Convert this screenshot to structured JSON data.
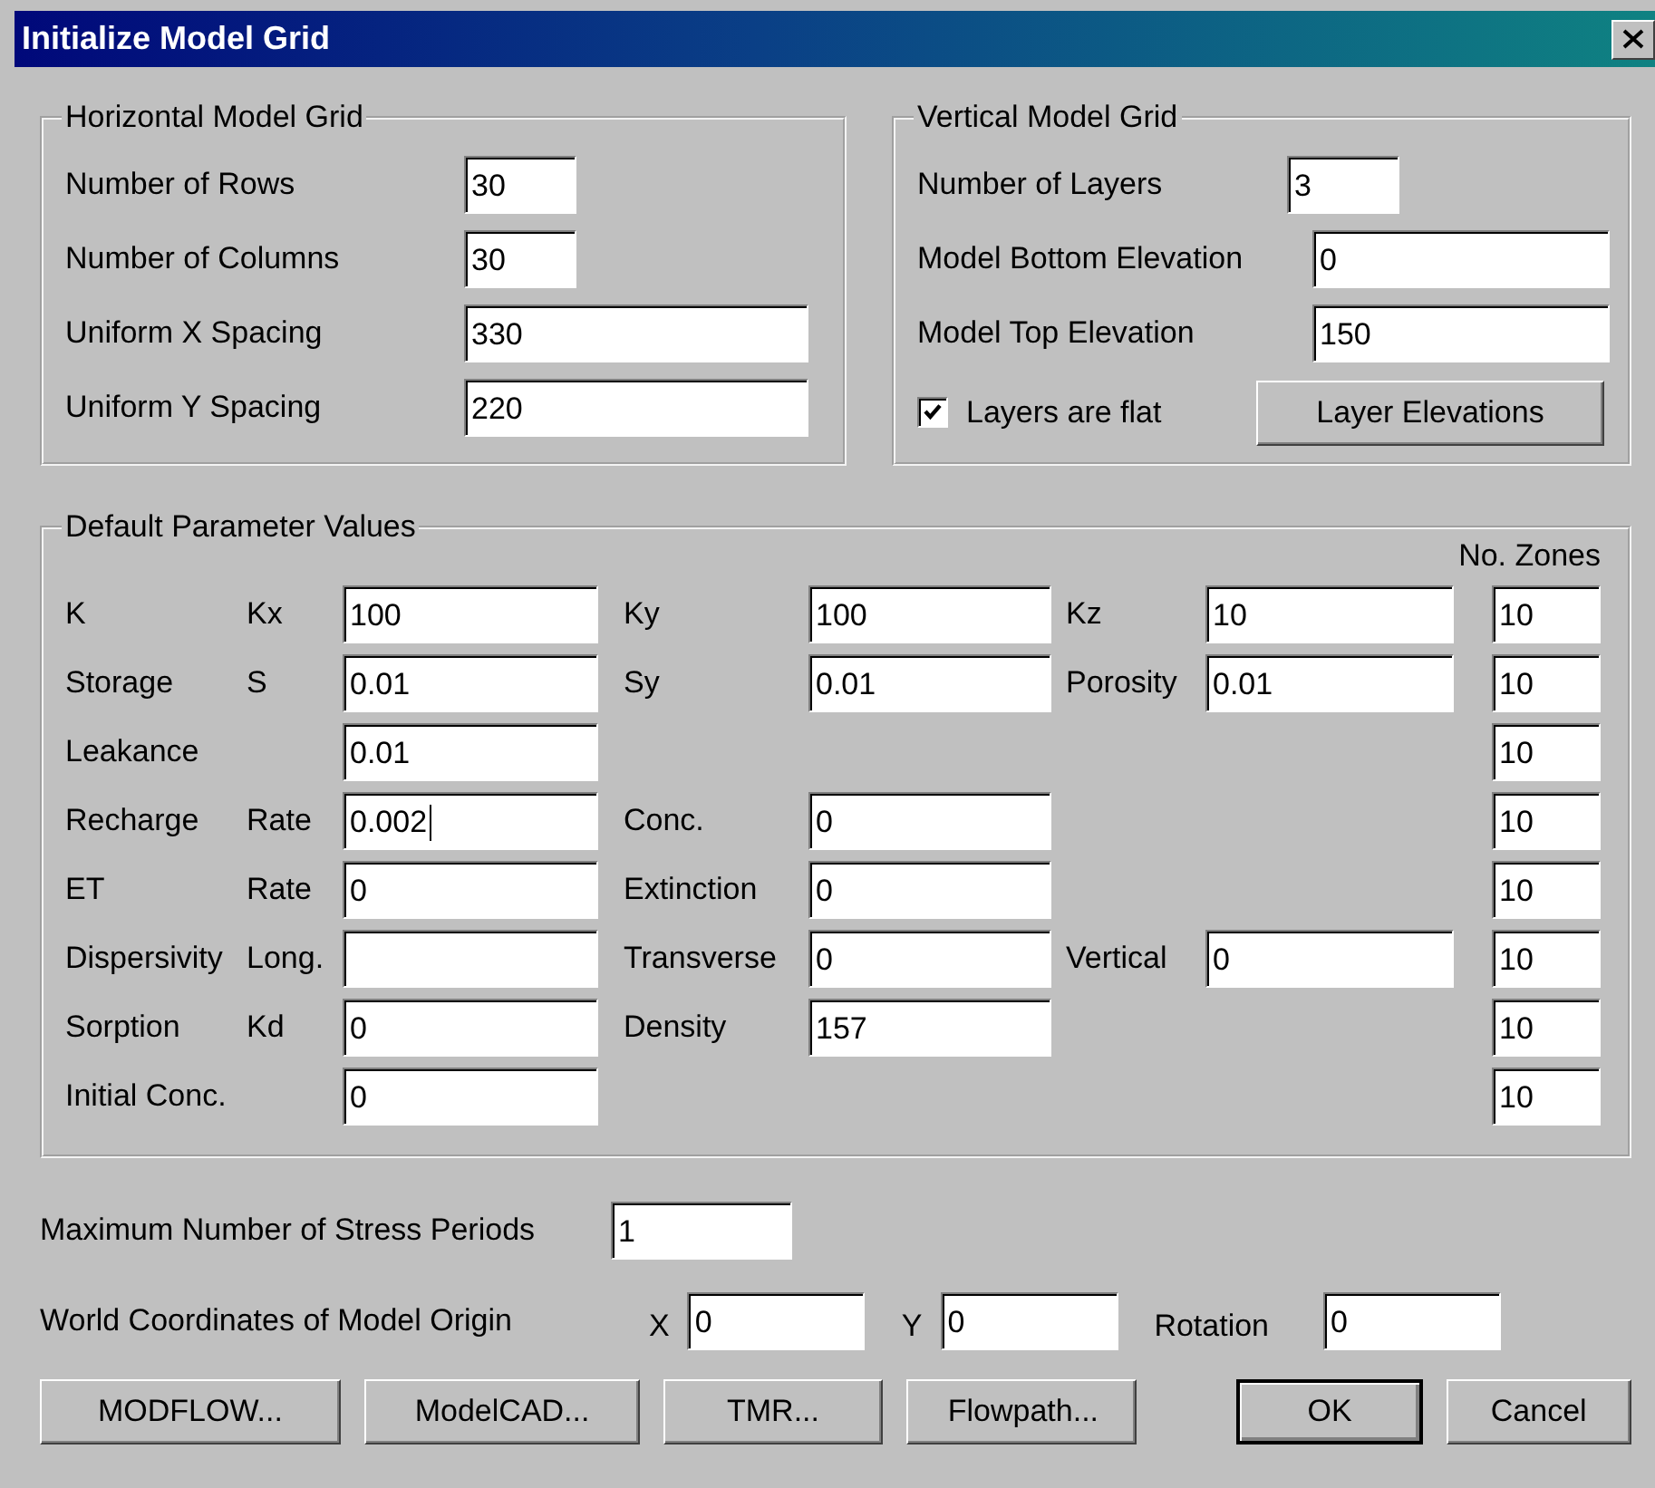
{
  "window": {
    "title": "Initialize Model Grid"
  },
  "horizontal_grid": {
    "title": "Horizontal Model Grid",
    "fields": [
      {
        "label": "Number of Rows",
        "value": "30",
        "kind": "short"
      },
      {
        "label": "Number of Columns",
        "value": "30",
        "kind": "short"
      },
      {
        "label": "Uniform X Spacing",
        "value": "330",
        "kind": "long"
      },
      {
        "label": "Uniform Y Spacing",
        "value": "220",
        "kind": "long"
      }
    ]
  },
  "vertical_grid": {
    "title": "Vertical Model Grid",
    "fields": [
      {
        "label": "Number of Layers",
        "value": "3",
        "kind": "short"
      },
      {
        "label": "Model Bottom Elevation",
        "value": "0",
        "kind": "long"
      },
      {
        "label": "Model Top Elevation",
        "value": "150",
        "kind": "long"
      }
    ],
    "flat_checkbox": {
      "label": "Layers are flat",
      "checked": true
    },
    "button": "Layer Elevations"
  },
  "parameters": {
    "title": "Default Parameter Values",
    "zones_header": "No. Zones",
    "rows": [
      {
        "label": "K",
        "sub_label": "Kx",
        "value": "100",
        "col2": {
          "label": "Ky",
          "value": "100"
        },
        "col3": {
          "label": "Kz",
          "value": "10"
        },
        "zones": "10"
      },
      {
        "label": "Storage",
        "sub_label": "S",
        "value": "0.01",
        "col2": {
          "label": "Sy",
          "value": "0.01"
        },
        "col3": {
          "label": "Porosity",
          "value": "0.01"
        },
        "zones": "10"
      },
      {
        "label": "Leakance",
        "value": "0.01",
        "zones": "10"
      },
      {
        "label": "Recharge",
        "sub_label": "Rate",
        "value": "0.002",
        "focused": true,
        "col2": {
          "label": "Conc.",
          "value": "0"
        },
        "zones": "10"
      },
      {
        "label": "ET",
        "sub_label": "Rate",
        "value": "0",
        "col2": {
          "label": "Extinction",
          "value": "0"
        },
        "zones": "10"
      },
      {
        "label": "Dispersivity",
        "sub_label": "Long.",
        "col2": {
          "label": "Transverse",
          "value": "0"
        },
        "col3": {
          "label": "Vertical",
          "value": "0"
        },
        "zones": "10"
      },
      {
        "label": "Sorption",
        "sub_label": "Kd",
        "value": "0",
        "col2": {
          "label": "Density",
          "value": "157"
        },
        "zones": "10"
      },
      {
        "label": "Initial Conc.",
        "value": "0",
        "zones": "10"
      }
    ]
  },
  "stress_periods": {
    "label": "Maximum Number of Stress Periods",
    "value": "1"
  },
  "origin": {
    "label": "World Coordinates of Model Origin",
    "fields": [
      {
        "label": "X",
        "value": "0"
      },
      {
        "label": "Y",
        "value": "0"
      },
      {
        "label": "Rotation",
        "value": "0"
      }
    ]
  },
  "tool_buttons": [
    "MODFLOW...",
    "ModelCAD...",
    "TMR...",
    "Flowpath..."
  ],
  "dialog_buttons": [
    {
      "label": "OK",
      "default": true
    },
    {
      "label": "Cancel",
      "default": false
    }
  ]
}
